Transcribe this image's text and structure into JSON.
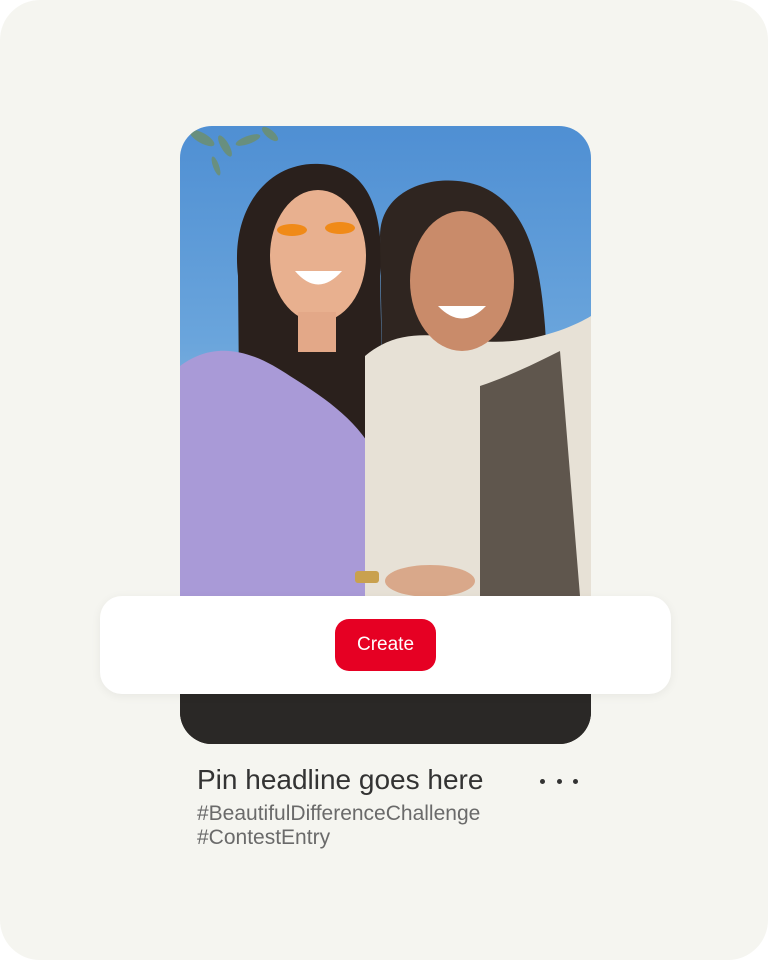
{
  "pin": {
    "image_alt": "Two smiling women sitting together outdoors",
    "create_label": "Create",
    "headline": "Pin headline goes here",
    "hashtags": [
      "#BeautifulDifferenceChallenge",
      "#ContestEntry"
    ]
  },
  "colors": {
    "background": "#f5f5f0",
    "brand_red": "#e60023",
    "title_text": "#333333",
    "tag_text": "#6a6a6a"
  },
  "icons": {
    "more": "more-horizontal-icon"
  }
}
